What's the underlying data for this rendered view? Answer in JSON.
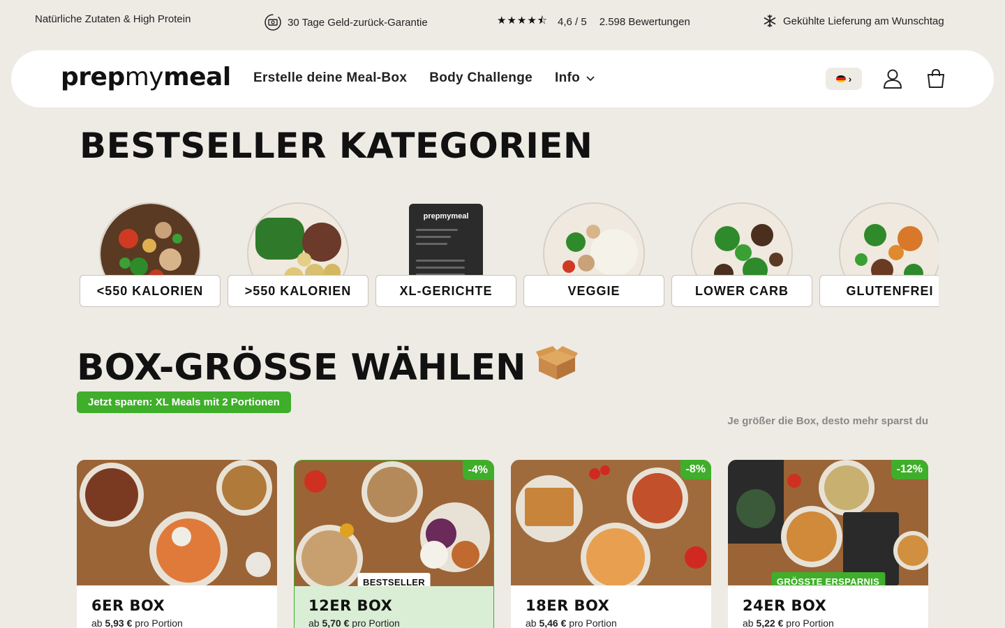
{
  "usp_bar": {
    "item1": "Natürliche Zutaten & High Protein",
    "item2": "30 Tage Geld-zurück-Garantie",
    "stars": "★★★★⯪",
    "rating": "4,6 / 5",
    "reviews": "2.598 Bewertungen",
    "item4": "Gekühlte Lieferung am Wunschtag"
  },
  "header": {
    "logo_bold_1": "prep",
    "logo_light": "my",
    "logo_bold_2": "meal",
    "nav": {
      "mealbox": "Erstelle deine Meal-Box",
      "challenge": "Body Challenge",
      "info": "Info"
    },
    "lang_chevron": "›"
  },
  "bestseller": {
    "title": "BESTSELLER KATEGORIEN",
    "categories": [
      {
        "label": "<550 KALORIEN"
      },
      {
        "label": ">550 KALORIEN"
      },
      {
        "label": "XL-GERICHTE"
      },
      {
        "label": "VEGGIE"
      },
      {
        "label": "LOWER CARB"
      },
      {
        "label": "GLUTENFREI"
      }
    ],
    "package_logo": "prepmymeal"
  },
  "box_section": {
    "title": "BOX-GRÖSSE WÄHLEN",
    "promo": "Jetzt sparen: XL Meals mit 2 Portionen",
    "hint": "Je größer die Box, desto mehr sparst du",
    "price_prefix": "ab",
    "price_suffix": "pro Portion",
    "boxes": [
      {
        "title": "6ER BOX",
        "price": "5,93 €",
        "discount": "",
        "ribbon": ""
      },
      {
        "title": "12ER BOX",
        "price": "5,70 €",
        "discount": "-4%",
        "ribbon": "BESTSELLER"
      },
      {
        "title": "18ER BOX",
        "price": "5,46 €",
        "discount": "-8%",
        "ribbon": ""
      },
      {
        "title": "24ER BOX",
        "price": "5,22 €",
        "discount": "-12%",
        "ribbon": "GRÖSSTE ERSPARNIS"
      }
    ]
  },
  "colors": {
    "background": "#eeebe5",
    "accent_green": "#3fae2a",
    "selected_card": "#d9eed5"
  },
  "icons": [
    "money-back-icon",
    "star-icon",
    "snowflake-icon",
    "chevron-down-icon",
    "german-flag-icon",
    "user-icon",
    "cart-icon",
    "box-emoji-icon"
  ]
}
